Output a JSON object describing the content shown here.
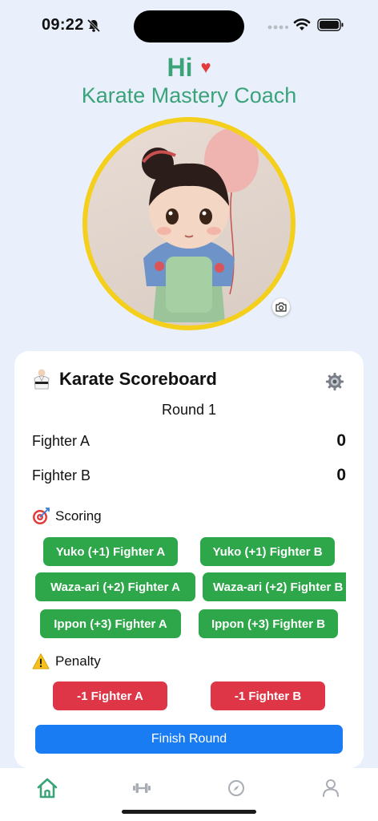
{
  "status_bar": {
    "time": "09:22"
  },
  "header": {
    "greeting": "Hi",
    "heart": "♥",
    "title": "Karate Mastery Coach"
  },
  "scoreboard": {
    "title": "Karate Scoreboard",
    "round": "Round 1",
    "fighters": [
      {
        "name": "Fighter A",
        "score": "0"
      },
      {
        "name": "Fighter B",
        "score": "0"
      }
    ],
    "scoring_label": "Scoring",
    "scoring_buttons": [
      "Yuko (+1) Fighter A",
      "Yuko (+1) Fighter B",
      "Waza-ari (+2) Fighter A",
      "Waza-ari (+2) Fighter B",
      "Ippon (+3) Fighter A",
      "Ippon (+3) Fighter B"
    ],
    "penalty_label": "Penalty",
    "penalty_buttons": [
      "-1 Fighter A",
      "-1 Fighter B"
    ],
    "finish_button": "Finish Round"
  },
  "tabs": [
    {
      "icon": "home-icon",
      "active": true
    },
    {
      "icon": "dumbbell-icon",
      "active": false
    },
    {
      "icon": "compass-icon",
      "active": false
    },
    {
      "icon": "person-icon",
      "active": false
    }
  ],
  "colors": {
    "background": "#EAF0FB",
    "accent_green": "#3BA37A",
    "score_green": "#2EA64A",
    "penalty_red": "#DE3646",
    "finish_blue": "#1A7CF2",
    "avatar_ring": "#F4CF1C"
  }
}
